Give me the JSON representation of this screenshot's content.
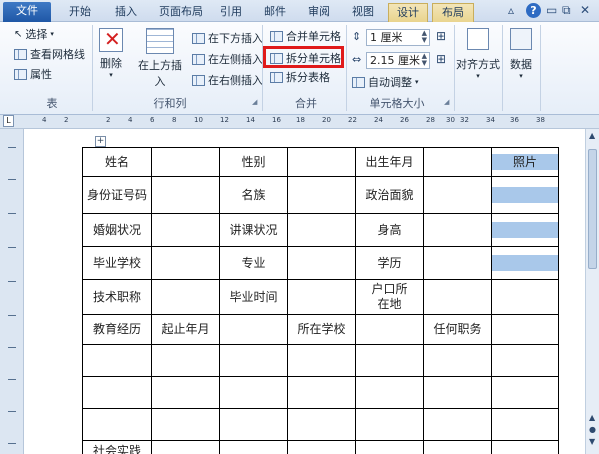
{
  "tabs": [
    "文件",
    "开始",
    "插入",
    "页面布局",
    "引用",
    "邮件",
    "审阅",
    "视图",
    "设计",
    "布局"
  ],
  "window_controls": [
    "▵",
    "?",
    "▭",
    "⧉",
    "✕"
  ],
  "ribbon": {
    "table_group": {
      "select": "选择",
      "gridlines": "查看网格线",
      "properties": "属性",
      "label": "表"
    },
    "rows_cols_group": {
      "delete": "删除",
      "insert_above": "在上方插入",
      "insert_below": "在下方插入",
      "insert_left": "在左侧插入",
      "insert_right": "在右侧插入",
      "label": "行和列"
    },
    "merge_group": {
      "merge_cells": "合并单元格",
      "split_cells": "拆分单元格",
      "split_table": "拆分表格",
      "label": "合并"
    },
    "cell_size_group": {
      "height": "1 厘米",
      "width": "2.15 厘米",
      "autofit": "自动调整",
      "label": "单元格大小"
    },
    "alignment": "对齐方式",
    "data": "数据"
  },
  "ruler_ticks": [
    "4",
    "2",
    "2",
    "4",
    "6",
    "8",
    "10",
    "12",
    "14",
    "16",
    "18",
    "20",
    "22",
    "24",
    "26",
    "28",
    "30",
    "32",
    "34",
    "36",
    "38"
  ],
  "grid_handle": "+",
  "table": {
    "rows": [
      [
        "姓名",
        "",
        "性别",
        "",
        "出生年月",
        "",
        "照片"
      ],
      [
        "身份证号码",
        "",
        "名族",
        "",
        "政治面貌",
        "",
        ""
      ],
      [
        "婚姻状况",
        "",
        "讲课状况",
        "",
        "身高",
        "",
        ""
      ],
      [
        "毕业学校",
        "",
        "专业",
        "",
        "学历",
        "",
        ""
      ],
      [
        "技术职称",
        "",
        "毕业时间",
        "",
        "户口所在地",
        "",
        ""
      ],
      [
        "教育经历",
        "起止年月",
        "",
        "所在学校",
        "",
        "任何职务",
        ""
      ],
      [
        "",
        "",
        "",
        "",
        "",
        "",
        ""
      ],
      [
        "",
        "",
        "",
        "",
        "",
        "",
        ""
      ],
      [
        "",
        "",
        "",
        "",
        "",
        "",
        ""
      ],
      [
        "社会实践",
        "",
        "",
        "",
        "",
        "",
        ""
      ]
    ]
  },
  "colors": {
    "highlight": "#e01a1a",
    "selection": "#a9c8ea",
    "file_tab": "#2a63b4"
  }
}
